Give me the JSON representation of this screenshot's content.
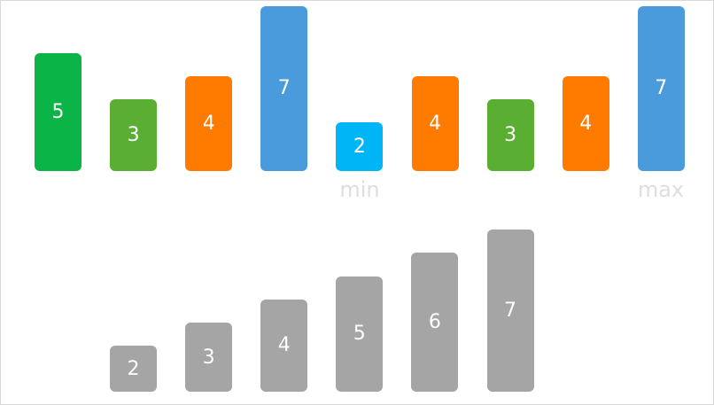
{
  "top_row": {
    "bars": [
      {
        "value": 5,
        "label": "5",
        "color": "#0bb446"
      },
      {
        "value": 3,
        "label": "3",
        "color": "#5aaf33"
      },
      {
        "value": 4,
        "label": "4",
        "color": "#ff7b00"
      },
      {
        "value": 7,
        "label": "7",
        "color": "#4a9bdc"
      },
      {
        "value": 2,
        "label": "2",
        "color": "#00b5f5"
      },
      {
        "value": 4,
        "label": "4",
        "color": "#ff7b00"
      },
      {
        "value": 3,
        "label": "3",
        "color": "#5aaf33"
      },
      {
        "value": 4,
        "label": "4",
        "color": "#ff7b00"
      },
      {
        "value": 7,
        "label": "7",
        "color": "#4a9bdc"
      }
    ],
    "min_label": "min",
    "max_label": "max"
  },
  "bottom_row": {
    "bars": [
      {
        "value": 2,
        "label": "2"
      },
      {
        "value": 3,
        "label": "3"
      },
      {
        "value": 4,
        "label": "4"
      },
      {
        "value": 5,
        "label": "5"
      },
      {
        "value": 6,
        "label": "6"
      },
      {
        "value": 7,
        "label": "7"
      }
    ],
    "color": "#a5a5a5"
  }
}
